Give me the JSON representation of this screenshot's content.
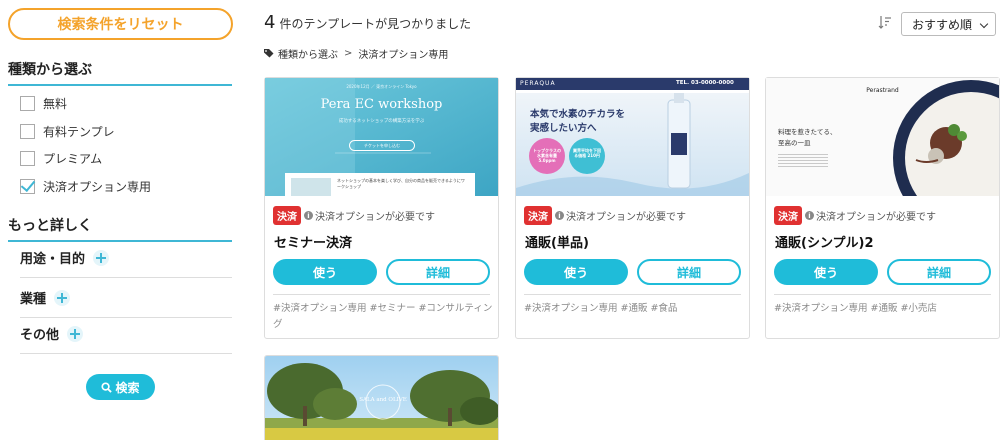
{
  "sidebar": {
    "reset_label": "検索条件をリセット",
    "category_title": "種類から選ぶ",
    "categories": [
      {
        "label": "無料",
        "checked": false
      },
      {
        "label": "有料テンプレ",
        "checked": false
      },
      {
        "label": "プレミアム",
        "checked": false
      },
      {
        "label": "決済オプション専用",
        "checked": true
      }
    ],
    "more_title": "もっと詳しく",
    "details": [
      {
        "label": "用途・目的"
      },
      {
        "label": "業種"
      },
      {
        "label": "その他"
      }
    ],
    "search_label": "検索"
  },
  "results": {
    "count": "4",
    "count_text": "件のテンプレートが見つかりました",
    "sort_value": "おすすめ順"
  },
  "breadcrumb": {
    "parent": "種類から選ぶ",
    "separator": ">",
    "current": "決済オプション専用"
  },
  "cards": [
    {
      "badge": "決済",
      "note": "決済オプションが必要です",
      "title": "セミナー決済",
      "use_label": "使う",
      "detail_label": "詳細",
      "tags": "#決済オプション専用 #セミナー #コンサルティング",
      "thumb": {
        "logo": "Pera EC workshop",
        "top_text": "2020年12月 ／ 東京オンライン Tokyo",
        "sub_text": "成功するネットショップの構築方法を学ぶ",
        "button_text": "チケットを申し込む",
        "body_text": "ネットショップの基本を楽しく学び、自分の商品を販売できるようにワークショップ"
      }
    },
    {
      "badge": "決済",
      "note": "決済オプションが必要です",
      "title": "通販(単品)",
      "use_label": "使う",
      "detail_label": "詳細",
      "tags": "#決済オプション専用 #通販 #食品",
      "thumb": {
        "logo": "PERAQUA",
        "phone": "TEL. 03-0000-0000",
        "headline1": "本気で水素のチカラを",
        "headline2": "実感したい方へ",
        "bubble1": "トップクラスの水素含有量 5.0ppm",
        "bubble2": "業界平均を下回る価格 210円"
      }
    },
    {
      "badge": "決済",
      "note": "決済オプションが必要です",
      "title": "通販(シンプル)2",
      "use_label": "使う",
      "detail_label": "詳細",
      "tags": "#決済オプション専用 #通販 #小売店",
      "thumb": {
        "logo": "Perastrand",
        "line1": "料理を惹きたてる、",
        "line2": "至高の一皿"
      }
    }
  ],
  "partial_card": {
    "logo": "SALA and OLIVE"
  },
  "colors": {
    "accent": "#1fbcd9",
    "reset": "#f4a32b",
    "badge": "#e03131"
  }
}
